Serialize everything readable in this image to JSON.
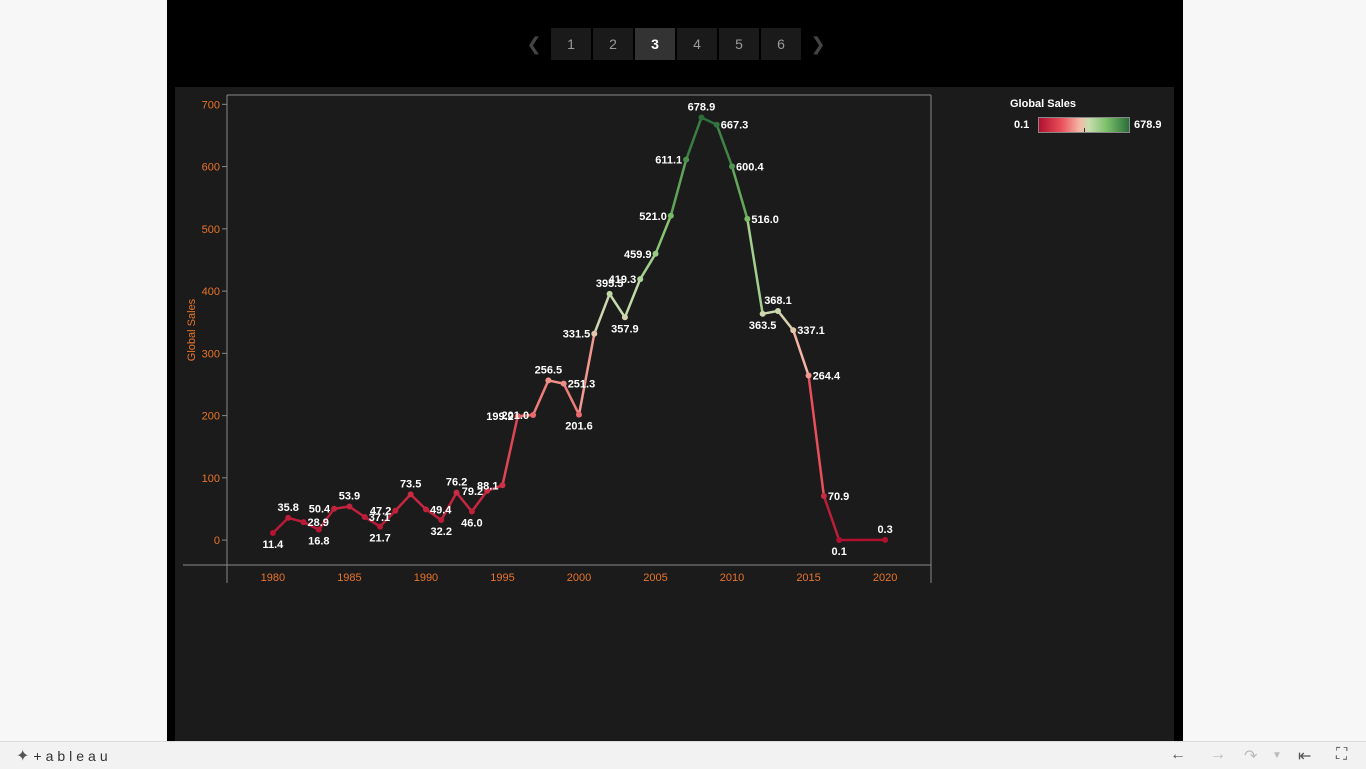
{
  "pager": {
    "prev_icon": "chevron-left-icon",
    "next_icon": "chevron-right-icon",
    "pages": [
      "1",
      "2",
      "3",
      "4",
      "5",
      "6"
    ],
    "active": "3"
  },
  "legend": {
    "title": "Global Sales",
    "min": "0.1",
    "max": "678.9"
  },
  "colors": {
    "low": "#b01030",
    "mid_low": "#e8505a",
    "mid": "#f5b7a6",
    "mid_high": "#7cc06a",
    "high": "#2b6e3a",
    "axis_text": "#e8742a",
    "background": "#1b1b1b"
  },
  "chart_data": {
    "type": "line",
    "ylabel": "Global Sales",
    "xlabel": "",
    "xlim": [
      1977,
      2023
    ],
    "ylim": [
      -40,
      715
    ],
    "x_ticks": [
      1980,
      1985,
      1990,
      1995,
      2000,
      2005,
      2010,
      2015,
      2020
    ],
    "y_ticks": [
      0,
      100,
      200,
      300,
      400,
      500,
      600,
      700
    ],
    "color_scale": {
      "min": 0.1,
      "max": 678.9
    },
    "points": [
      {
        "x": 1980,
        "y": 11.4,
        "label": "11.4"
      },
      {
        "x": 1981,
        "y": 35.8,
        "label": "35.8"
      },
      {
        "x": 1982,
        "y": 28.9,
        "label": "28.9"
      },
      {
        "x": 1983,
        "y": 16.8,
        "label": "16.8"
      },
      {
        "x": 1984,
        "y": 50.4,
        "label": "50.4"
      },
      {
        "x": 1985,
        "y": 53.9,
        "label": "53.9"
      },
      {
        "x": 1986,
        "y": 37.1,
        "label": "37.1"
      },
      {
        "x": 1987,
        "y": 21.7,
        "label": "21.7"
      },
      {
        "x": 1988,
        "y": 47.2,
        "label": "47.2"
      },
      {
        "x": 1989,
        "y": 73.5,
        "label": "73.5"
      },
      {
        "x": 1990,
        "y": 49.4,
        "label": "49.4"
      },
      {
        "x": 1991,
        "y": 32.2,
        "label": "32.2"
      },
      {
        "x": 1992,
        "y": 76.2,
        "label": "76.2"
      },
      {
        "x": 1993,
        "y": 46.0,
        "label": "46.0"
      },
      {
        "x": 1994,
        "y": 79.2,
        "label": "79.2"
      },
      {
        "x": 1995,
        "y": 88.1,
        "label": "88.1"
      },
      {
        "x": 1996,
        "y": 199.2,
        "label": "199.2"
      },
      {
        "x": 1997,
        "y": 201.0,
        "label": "201.0"
      },
      {
        "x": 1998,
        "y": 256.5,
        "label": "256.5"
      },
      {
        "x": 1999,
        "y": 251.3,
        "label": "251.3"
      },
      {
        "x": 2000,
        "y": 201.6,
        "label": "201.6"
      },
      {
        "x": 2001,
        "y": 331.5,
        "label": "331.5"
      },
      {
        "x": 2002,
        "y": 395.5,
        "label": "395.5"
      },
      {
        "x": 2003,
        "y": 357.9,
        "label": "357.9"
      },
      {
        "x": 2004,
        "y": 419.3,
        "label": "419.3"
      },
      {
        "x": 2005,
        "y": 459.9,
        "label": "459.9"
      },
      {
        "x": 2006,
        "y": 521.0,
        "label": "521.0"
      },
      {
        "x": 2007,
        "y": 611.1,
        "label": "611.1"
      },
      {
        "x": 2008,
        "y": 678.9,
        "label": "678.9"
      },
      {
        "x": 2009,
        "y": 667.3,
        "label": "667.3"
      },
      {
        "x": 2010,
        "y": 600.4,
        "label": "600.4"
      },
      {
        "x": 2011,
        "y": 516.0,
        "label": "516.0"
      },
      {
        "x": 2012,
        "y": 363.5,
        "label": "363.5"
      },
      {
        "x": 2013,
        "y": 368.1,
        "label": "368.1"
      },
      {
        "x": 2014,
        "y": 337.1,
        "label": "337.1"
      },
      {
        "x": 2015,
        "y": 264.4,
        "label": "264.4"
      },
      {
        "x": 2016,
        "y": 70.9,
        "label": "70.9"
      },
      {
        "x": 2017,
        "y": 0.1,
        "label": "0.1"
      },
      {
        "x": 2020,
        "y": 0.3,
        "label": "0.3"
      }
    ],
    "grid": false,
    "legend_position": "top-right"
  },
  "footer": {
    "logo_text": "+ableau",
    "logo_icon": "tableau-logo-icon",
    "undo_icon": "undo-arrow-icon",
    "redo_icon": "redo-arrow-icon",
    "revert_icon": "revert-icon",
    "reset_icon": "reset-to-start-icon",
    "fullscreen_icon": "fullscreen-icon"
  }
}
